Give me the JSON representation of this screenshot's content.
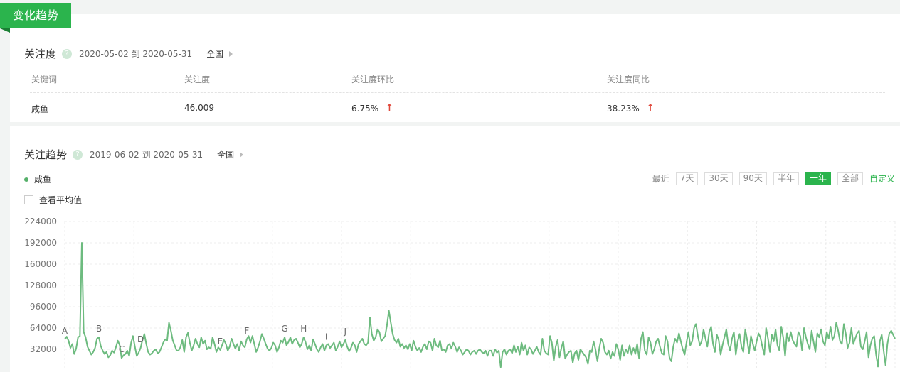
{
  "header": {
    "title": "变化趋势"
  },
  "attention": {
    "title": "关注度",
    "help_icon": "question-circle-icon",
    "date_range": "2020-05-02 到 2020-05-31",
    "region": "全国",
    "columns": [
      "关键词",
      "关注度",
      "关注度环比",
      "关注度同比"
    ],
    "row": {
      "keyword": "咸鱼",
      "value": "46,009",
      "mom": "6.75%",
      "yoy": "38.23%"
    },
    "arrow_color": "#e0473a"
  },
  "trend": {
    "title": "关注趋势",
    "help_icon": "question-circle-icon",
    "date_range": "2019-06-02 到 2020-05-31",
    "region": "全国",
    "legend": "咸鱼",
    "avg_label": "查看平均值",
    "range_label": "最近",
    "ranges": [
      "7天",
      "30天",
      "90天",
      "半年",
      "一年",
      "全部"
    ],
    "active_range": "一年",
    "custom_label": "自定义"
  },
  "colors": {
    "accent": "#2bb44d",
    "line": "#6dbb7f"
  },
  "chart_data": {
    "type": "line",
    "x_start": "2019-06-02",
    "x_end": "2020-05-31",
    "ylim": [
      0,
      224000
    ],
    "yticks": [
      "224000",
      "192000",
      "160000",
      "128000",
      "96000",
      "64000",
      "32000"
    ],
    "grid": true,
    "legend": "top-left",
    "annotations": [
      {
        "label": "A",
        "index": 0
      },
      {
        "label": "B",
        "index": 18
      },
      {
        "label": "C",
        "index": 30
      },
      {
        "label": "D",
        "index": 40
      },
      {
        "label": "E",
        "index": 82
      },
      {
        "label": "F",
        "index": 96
      },
      {
        "label": "G",
        "index": 116
      },
      {
        "label": "H",
        "index": 126
      },
      {
        "label": "I",
        "index": 138
      },
      {
        "label": "J",
        "index": 148
      }
    ],
    "series": [
      {
        "name": "咸鱼",
        "values": [
          47000,
          51000,
          45000,
          34000,
          40000,
          25000,
          33000,
          50000,
          52000,
          192000,
          58000,
          50000,
          36000,
          30000,
          24000,
          28000,
          34000,
          48000,
          50000,
          37000,
          30000,
          25000,
          28000,
          20000,
          23000,
          30000,
          27000,
          35000,
          45000,
          38000,
          19000,
          23000,
          25000,
          30000,
          22000,
          42000,
          52000,
          36000,
          22000,
          27000,
          34000,
          46000,
          55000,
          40000,
          28000,
          24000,
          26000,
          30000,
          32000,
          26000,
          28000,
          35000,
          42000,
          47000,
          45000,
          72000,
          60000,
          45000,
          38000,
          30000,
          30000,
          35000,
          46000,
          28000,
          50000,
          57000,
          42000,
          30000,
          38000,
          48000,
          40000,
          35000,
          50000,
          40000,
          45000,
          32000,
          35000,
          33000,
          50000,
          40000,
          28000,
          35000,
          31000,
          38000,
          46000,
          40000,
          30000,
          36000,
          48000,
          40000,
          33000,
          40000,
          30000,
          44000,
          38000,
          35000,
          47000,
          52000,
          42000,
          52000,
          40000,
          28000,
          35000,
          44000,
          55000,
          48000,
          40000,
          33000,
          30000,
          34000,
          42000,
          38000,
          28000,
          35000,
          45000,
          42000,
          50000,
          38000,
          43000,
          50000,
          40000,
          46000,
          48000,
          42000,
          35000,
          40000,
          50000,
          43000,
          32000,
          38000,
          30000,
          47000,
          40000,
          32000,
          28000,
          35000,
          40000,
          30000,
          38000,
          40000,
          34000,
          38000,
          42000,
          30000,
          36000,
          44000,
          35000,
          40000,
          46000,
          36000,
          29000,
          34000,
          42000,
          38000,
          28000,
          40000,
          44000,
          48000,
          40000,
          38000,
          42000,
          80000,
          55000,
          45000,
          50000,
          62000,
          58000,
          44000,
          48000,
          52000,
          68000,
          90000,
          72000,
          55000,
          46000,
          42000,
          48000,
          36000,
          40000,
          34000,
          38000,
          32000,
          40000,
          30000,
          45000,
          36000,
          30000,
          34000,
          28000,
          36000,
          40000,
          32000,
          44000,
          42000,
          30000,
          48000,
          38000,
          35000,
          45000,
          30000,
          32000,
          28000,
          38000,
          40000,
          33000,
          42000,
          36000,
          28000,
          35000,
          30000,
          24000,
          28000,
          32000,
          30000,
          24000,
          28000,
          30000,
          25000,
          30000,
          32000,
          28000,
          26000,
          30000,
          22000,
          30000,
          30000,
          22000,
          32000,
          27000,
          30000,
          5000,
          28000,
          32000,
          24000,
          30000,
          32000,
          26000,
          38000,
          28000,
          36000,
          24000,
          42000,
          30000,
          38000,
          24000,
          35000,
          32000,
          25000,
          30000,
          36000,
          28000,
          24000,
          48000,
          30000,
          26000,
          24000,
          52000,
          42000,
          15000,
          36000,
          46000,
          20000,
          34000,
          44000,
          18000,
          24000,
          28000,
          30000,
          12000,
          26000,
          30000,
          16000,
          32000,
          28000,
          24000,
          20000,
          10000,
          30000,
          28000,
          44000,
          32000,
          14000,
          34000,
          48000,
          42000,
          28000,
          24000,
          30000,
          18000,
          28000,
          22000,
          40000,
          32000,
          16000,
          38000,
          22000,
          32000,
          26000,
          38000,
          24000,
          34000,
          25000,
          40000,
          18000,
          48000,
          58000,
          30000,
          24000,
          50000,
          42000,
          25000,
          32000,
          44000,
          48000,
          36000,
          26000,
          24000,
          52000,
          44000,
          20000,
          14000,
          36000,
          48000,
          42000,
          56000,
          44000,
          32000,
          24000,
          42000,
          58000,
          38000,
          44000,
          64000,
          70000,
          52000,
          38000,
          44000,
          62000,
          48000,
          36000,
          58000,
          66000,
          40000,
          28000,
          54000,
          46000,
          24000,
          38000,
          50000,
          62000,
          40000,
          30000,
          48000,
          58000,
          24000,
          44000,
          55000,
          36000,
          28000,
          62000,
          46000,
          26000,
          52000,
          40000,
          30000,
          44000,
          56000,
          50000,
          36000,
          24000,
          64000,
          48000,
          28000,
          54000,
          44000,
          62000,
          38000,
          30000,
          66000,
          50000,
          22000,
          56000,
          44000,
          58000,
          46000,
          40000,
          36000,
          58000,
          52000,
          30000,
          64000,
          50000,
          40000,
          32000,
          60000,
          44000,
          28000,
          56000,
          50000,
          62000,
          44000,
          38000,
          58000,
          48000,
          66000,
          46000,
          52000,
          72000,
          60000,
          44000,
          40000,
          70000,
          56000,
          34000,
          42000,
          64000,
          40000,
          48000,
          56000,
          60000,
          36000,
          32000,
          44000,
          58000,
          20000,
          38000,
          48000,
          52000,
          24000,
          6000,
          44000,
          54000,
          30000,
          8000,
          40000,
          56000,
          60000,
          54000,
          48000
        ]
      }
    ]
  }
}
